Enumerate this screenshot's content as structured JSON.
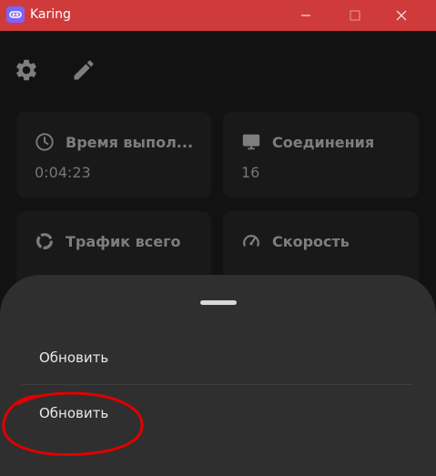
{
  "window": {
    "title": "Karing",
    "titlebar_color": "#cf3b3b",
    "controls": [
      "minimize-icon",
      "maximize-icon",
      "close-icon"
    ]
  },
  "toolbar": {
    "icons": [
      "gear-icon",
      "pencil-icon"
    ]
  },
  "cards": {
    "uptime": {
      "icon": "clock-icon",
      "title": "Время выпол...",
      "value": "0:04:23"
    },
    "connections": {
      "icon": "monitor-icon",
      "title": "Соединения",
      "value": "16"
    },
    "traffic": {
      "icon": "donut-icon",
      "title": "Трафик всего"
    },
    "speed": {
      "icon": "speedometer-icon",
      "title": "Скорость"
    }
  },
  "sheet": {
    "items": [
      {
        "label": "Обновить"
      },
      {
        "label": "Обновить"
      }
    ]
  },
  "annotation": {
    "color": "#e00000",
    "shape": "red hand-drawn circle around second item"
  }
}
